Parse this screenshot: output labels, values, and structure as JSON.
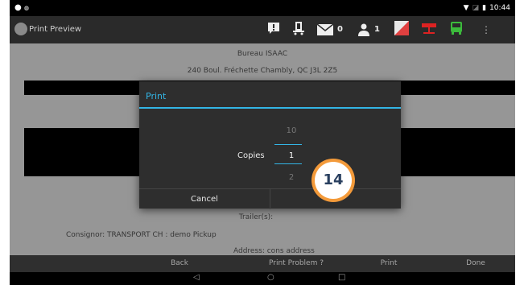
{
  "status_bar": {
    "time": "10:44"
  },
  "action_bar": {
    "title": "Print Preview",
    "mail_count": "0",
    "person_count": "1"
  },
  "document": {
    "company": "Bureau ISAAC",
    "address": "240 Boul. Fréchette Chambly, QC J3L 2Z5",
    "trailers": "Trailer(s):",
    "consignor": "Consignor:  TRANSPORT CH : demo Pickup",
    "address_line": "Address:  cons address"
  },
  "dialog": {
    "title": "Print",
    "copies_label": "Copies",
    "picker_above": "10",
    "picker_value": "1",
    "picker_below": "2",
    "cancel_label": "Cancel"
  },
  "badge": {
    "number": "14"
  },
  "bottom_bar": {
    "back": "Back",
    "print_problem": "Print Problem ?",
    "print": "Print",
    "done": "Done"
  },
  "colors": {
    "accent": "#33b5e5",
    "badge_ring": "#f39a3a"
  },
  "icons": [
    "back-arrow-icon",
    "alert-icon",
    "truck-alert-icon",
    "mail-icon",
    "person-icon",
    "status-square-icon",
    "trailer-icon",
    "bus-icon",
    "overflow-icon",
    "wifi-icon",
    "battery-icon"
  ]
}
